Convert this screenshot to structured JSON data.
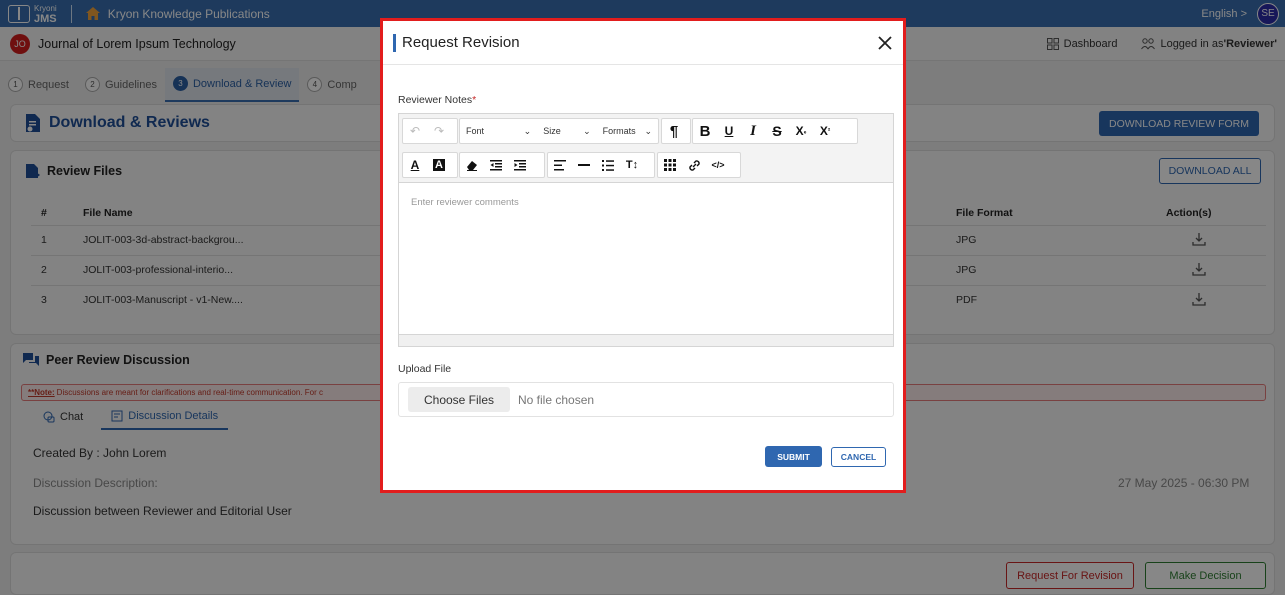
{
  "topbar": {
    "logo_small": "Kryoni",
    "logo_big": "JMS",
    "brand": "Kryon Knowledge Publications",
    "language": "English",
    "language_arrow": ">",
    "avatar_initials": "SE",
    "bg_color": "#3a6fb0"
  },
  "journal": {
    "avatar_initials": "JO",
    "title": "Journal of Lorem Ipsum Technology",
    "dashboard_label": "Dashboard",
    "logged_in_prefix": "Logged in as ",
    "logged_in_role": "'Reviewer'"
  },
  "steps": [
    {
      "num": "1",
      "label": "Request",
      "active": false
    },
    {
      "num": "2",
      "label": "Guidelines",
      "active": false
    },
    {
      "num": "3",
      "label": "Download & Review",
      "active": true
    },
    {
      "num": "4",
      "label": "Comp",
      "active": false
    }
  ],
  "download_section": {
    "title": "Download & Reviews",
    "button": "DOWNLOAD REVIEW FORM"
  },
  "review_files": {
    "title": "Review Files",
    "download_all": "DOWNLOAD ALL",
    "columns": [
      "#",
      "File Name",
      "File Format",
      "Action(s)"
    ],
    "rows": [
      {
        "num": "1",
        "name": "JOLIT-003-3d-abstract-backgrou...",
        "format": "JPG"
      },
      {
        "num": "2",
        "name": "JOLIT-003-professional-interio...",
        "format": "JPG"
      },
      {
        "num": "3",
        "name": "JOLIT-003-Manuscript - v1-New....",
        "format": "PDF"
      }
    ]
  },
  "peer_review": {
    "title": "Peer Review Discussion",
    "note_label": "**Note:",
    "note_text": " Discussions are meant for clarifications and real-time communication. For c",
    "tab_chat": "Chat",
    "tab_details": "Discussion Details",
    "created_by": "Created By : John Lorem",
    "description_label": "Discussion Description:",
    "date": "27 May 2025 - 06:30 PM",
    "description": "Discussion between Reviewer and Editorial User"
  },
  "bottom": {
    "request_revision": "Request For Revision",
    "make_decision": "Make Decision"
  },
  "modal": {
    "title": "Request Revision",
    "notes_label": "Reviewer Notes",
    "required_mark": "*",
    "font_select": "Font",
    "size_select": "Size",
    "formats_select": "Formats",
    "placeholder": "Enter reviewer comments",
    "upload_label": "Upload File",
    "choose_files": "Choose Files",
    "no_file": "No file chosen",
    "submit": "SUBMIT",
    "cancel": "CANCEL",
    "highlight_color": "#e21d1d"
  }
}
